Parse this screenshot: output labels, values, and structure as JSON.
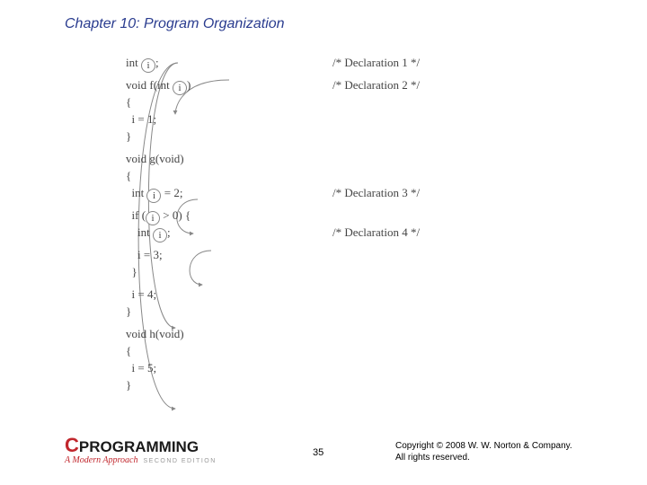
{
  "chapter": "Chapter 10: Program Organization",
  "var": "i",
  "code": {
    "l0a": "int ",
    "l0b": ";",
    "l1a": "void f(int ",
    "l1b": ")",
    "l2": "{",
    "l3": "  i = 1;",
    "l4": "}",
    "l5": "void g(void)",
    "l6": "{",
    "l7a": "  int ",
    "l7b": " = 2;",
    "l8a": "  if (",
    "l8b": " > 0) {",
    "l9a": "    int ",
    "l9b": ";",
    "l10": "    i = 3;",
    "l11": "  }",
    "l12": "  i = 4;",
    "l13": "}",
    "l14": "void h(void)",
    "l15": "{",
    "l16": "  i = 5;",
    "l17": "}"
  },
  "comments": {
    "c1": "/* Declaration 1 */",
    "c2": "/* Declaration 2 */",
    "c3": "/* Declaration 3 */",
    "c4": "/* Declaration 4 */"
  },
  "footer": {
    "logo_c": "C",
    "logo_main": "PROGRAMMING",
    "logo_sub": "A Modern Approach",
    "logo_edition": "SECOND EDITION",
    "page": "35",
    "copyright1": "Copyright © 2008 W. W. Norton & Company.",
    "copyright2": "All rights reserved."
  }
}
